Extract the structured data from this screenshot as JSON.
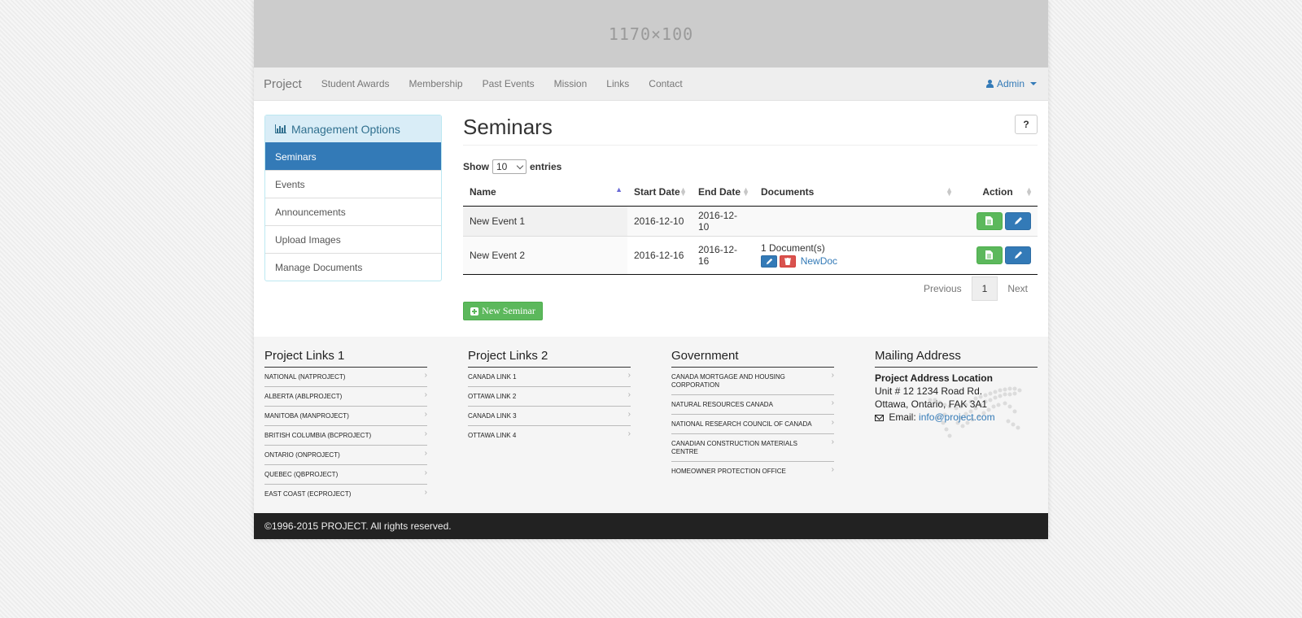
{
  "banner": {
    "placeholder": "1170×100"
  },
  "navbar": {
    "brand": "Project",
    "links": [
      "Student Awards",
      "Membership",
      "Past Events",
      "Mission",
      "Links",
      "Contact"
    ],
    "user": "Admin"
  },
  "sidebar": {
    "title": "Management Options",
    "items": [
      "Seminars",
      "Events",
      "Announcements",
      "Upload Images",
      "Manage Documents"
    ],
    "active": "Seminars"
  },
  "main": {
    "title": "Seminars",
    "help_label": "?",
    "show_label": "Show",
    "entries_value": "10",
    "entries_label": "entries",
    "columns": [
      "Name",
      "Start Date",
      "End Date",
      "Documents",
      "Action"
    ],
    "rows": [
      {
        "name": "New Event 1",
        "start": "2016-12-10",
        "end": "2016-12-10",
        "documents": "",
        "doc_name": ""
      },
      {
        "name": "New Event 2",
        "start": "2016-12-16",
        "end": "2016-12-16",
        "documents": "1 Document(s)",
        "doc_name": "NewDoc"
      }
    ],
    "pager": {
      "previous": "Previous",
      "page": "1",
      "next": "Next"
    },
    "new_button": "New Seminar"
  },
  "footer": {
    "col1": {
      "title": "Project Links 1",
      "links": [
        "NATIONAL (NATPROJECT)",
        "ALBERTA (ABLPROJECT)",
        "MANITOBA (MANPROJECT)",
        "BRITISH COLUMBIA (BCPROJECT)",
        "ONTARIO (ONPROJECT)",
        "QUEBEC (QBPROJECT)",
        "EAST COAST (ECPROJECT)"
      ]
    },
    "col2": {
      "title": "Project Links 2",
      "links": [
        "CANADA LINK 1",
        "OTTAWA LINK 2",
        "CANADA LINK 3",
        "OTTAWA LINK 4"
      ]
    },
    "col3": {
      "title": "Government",
      "links": [
        "CANADA MORTGAGE AND HOUSING CORPORATION",
        "NATURAL RESOURCES CANADA",
        "NATIONAL RESEARCH COUNCIL OF CANADA",
        "CANADIAN CONSTRUCTION MATERIALS CENTRE",
        "HOMEOWNER PROTECTION OFFICE"
      ]
    },
    "mailing": {
      "title": "Mailing Address",
      "heading": "Project Address Location",
      "line1": "Unit # 12 1234 Road Rd.",
      "line2": "Ottawa, Ontario, FAK 3A1",
      "email_label": "Email:",
      "email": "info@project.com"
    },
    "copyright": "©1996-2015 PROJECT. All rights reserved."
  },
  "colors": {
    "primary": "#337ab7",
    "success": "#5cb85c",
    "danger": "#d9534f",
    "info_bg": "#d9edf7"
  }
}
